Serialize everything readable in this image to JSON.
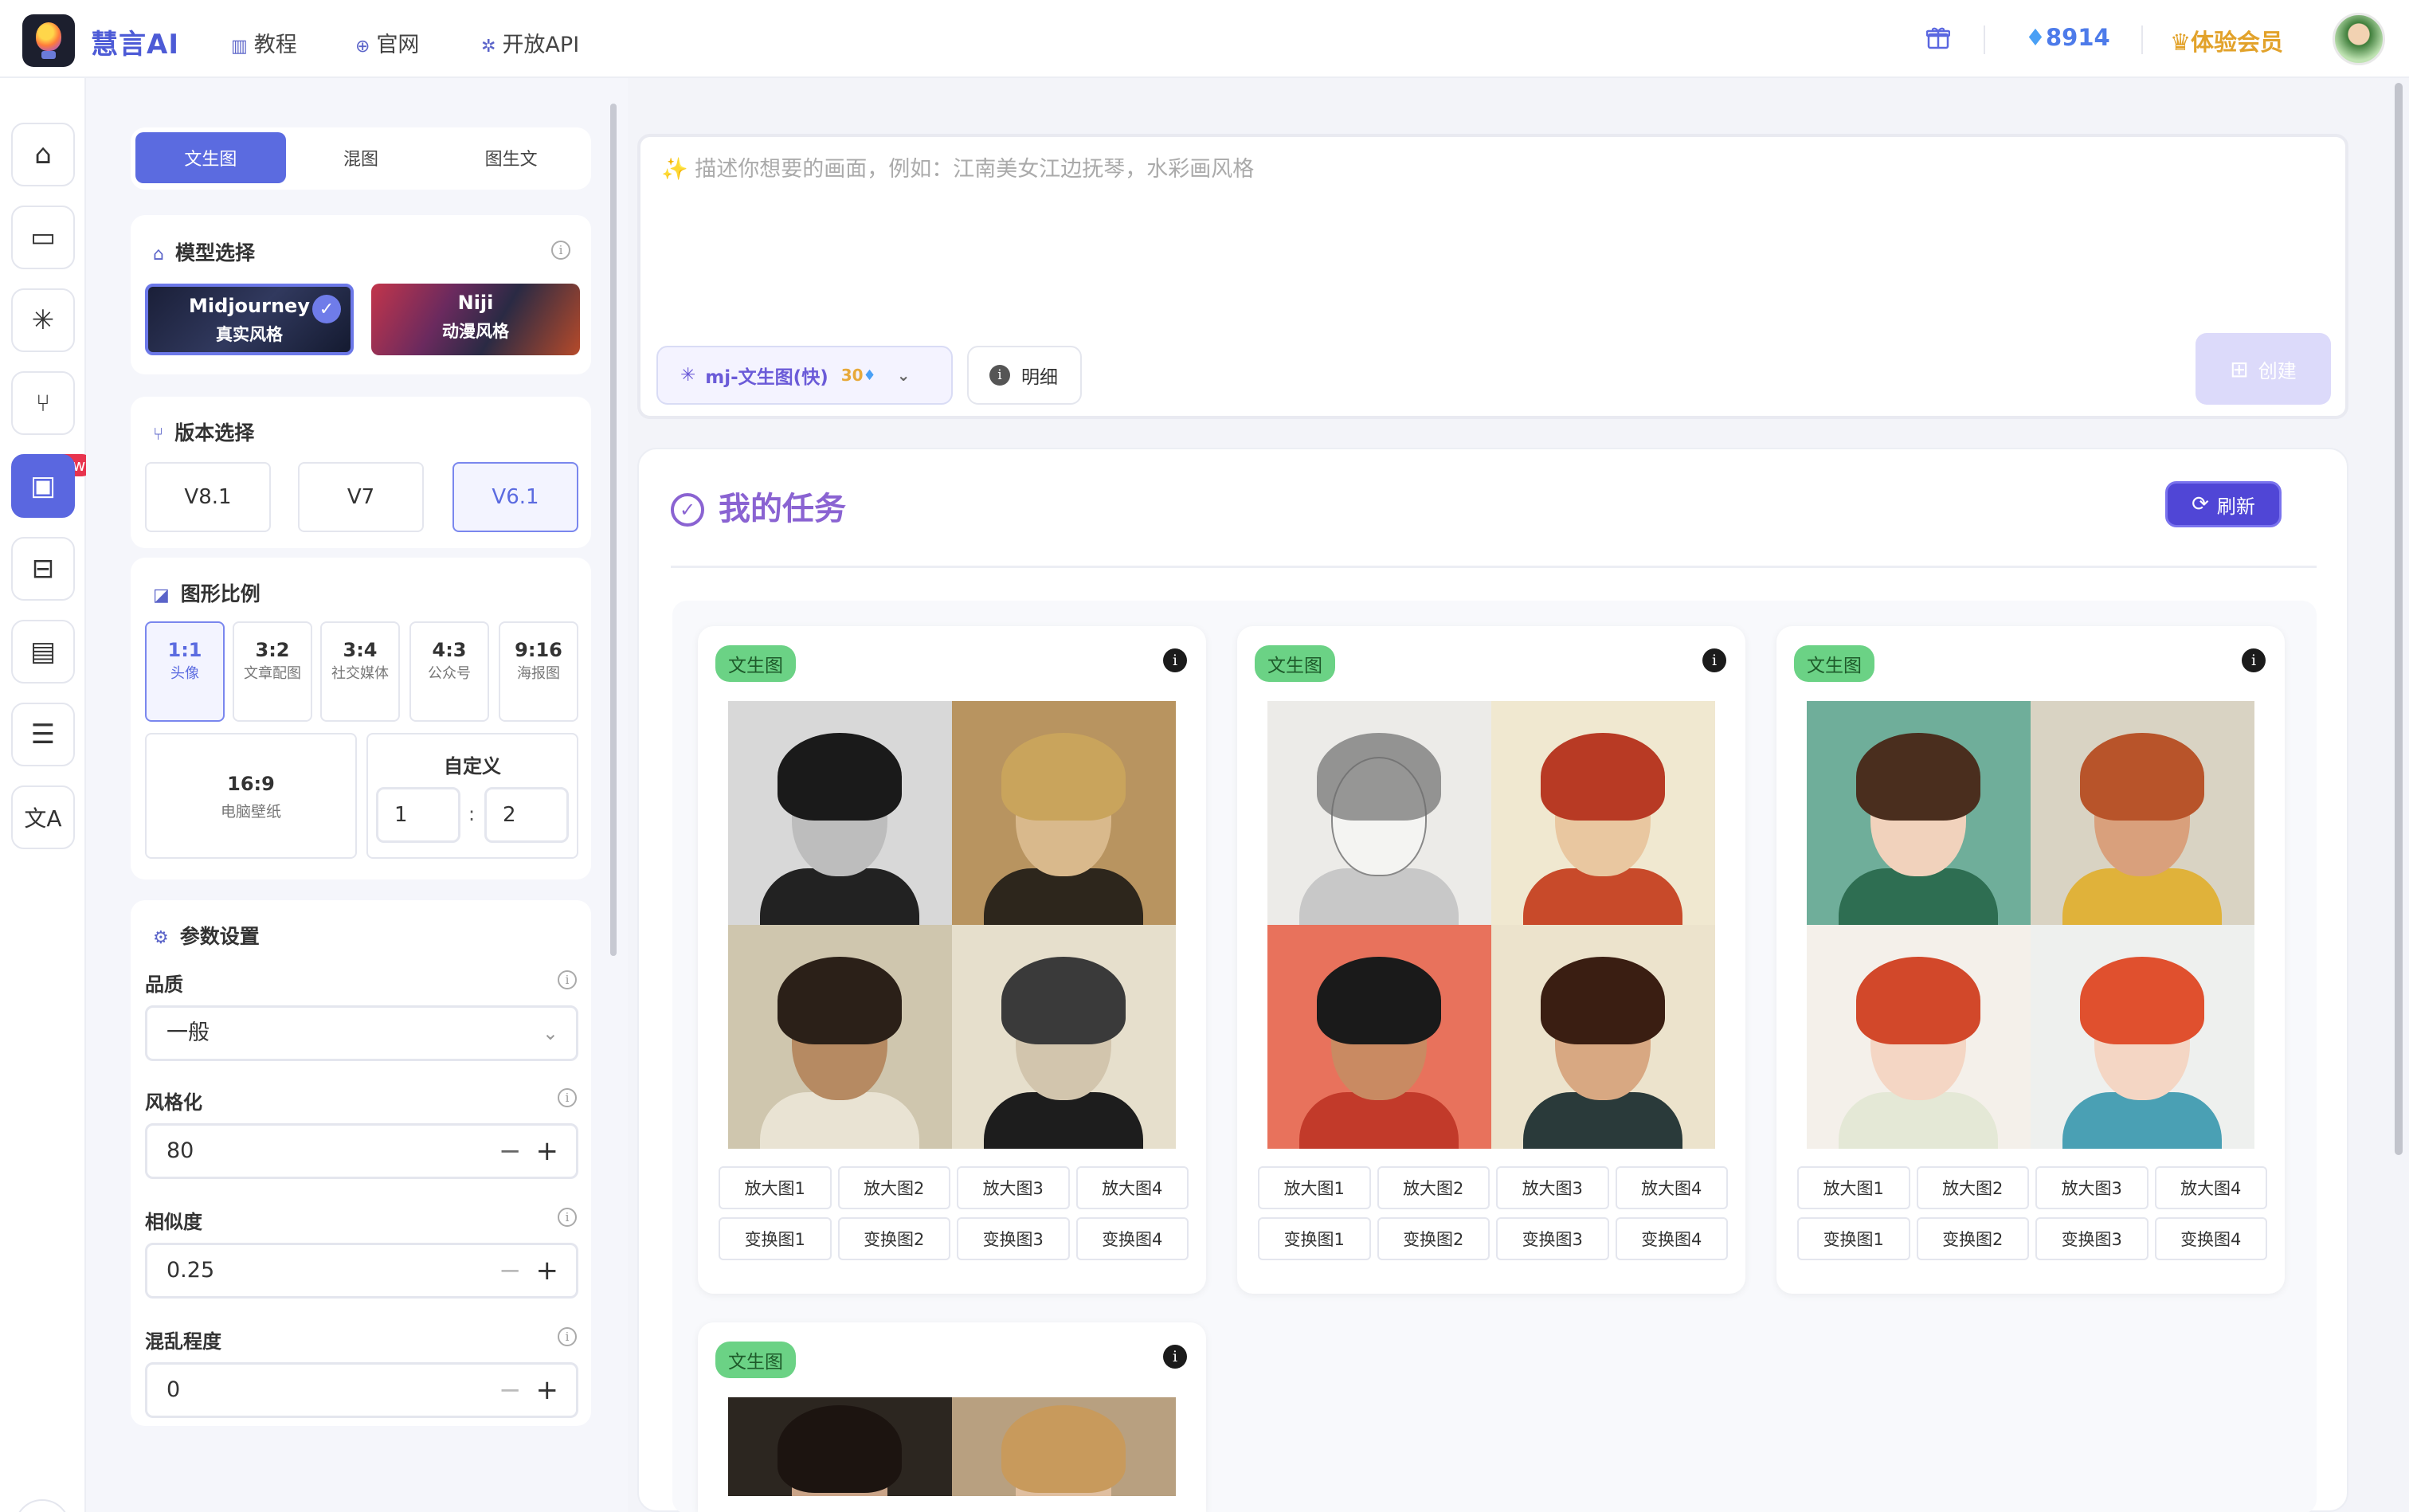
{
  "app": {
    "brand": "慧言AI",
    "nav": [
      {
        "icon": "book-icon",
        "glyph": "▥",
        "label": "教程"
      },
      {
        "icon": "globe-icon",
        "glyph": "⊕",
        "label": "官网"
      },
      {
        "icon": "api-icon",
        "glyph": "✲",
        "label": "开放API"
      }
    ],
    "gems": "8914",
    "vip": "体验会员"
  },
  "rail": {
    "items": [
      "home-icon",
      "chat-icon",
      "sparkle-icon",
      "branch-icon",
      "image-gen-icon",
      "bag-icon",
      "gallery-icon",
      "list-indent-icon",
      "translate-icon"
    ],
    "new_badge": "new"
  },
  "panel": {
    "tabs": [
      "文生图",
      "混图",
      "图生文"
    ],
    "active_tab": 0,
    "model_title": "模型选择",
    "models": [
      {
        "name": "Midjourney",
        "desc": "真实风格",
        "selected": true
      },
      {
        "name": "Niji",
        "desc": "动漫风格",
        "selected": false
      }
    ],
    "version_title": "版本选择",
    "versions": [
      "V8.1",
      "V7",
      "V6.1"
    ],
    "active_version": 2,
    "ratio_title": "图形比例",
    "ratios": [
      {
        "r": "1:1",
        "d": "头像"
      },
      {
        "r": "3:2",
        "d": "文章配图"
      },
      {
        "r": "3:4",
        "d": "社交媒体"
      },
      {
        "r": "4:3",
        "d": "公众号"
      },
      {
        "r": "9:16",
        "d": "海报图"
      }
    ],
    "ratio_wide": {
      "r": "16:9",
      "d": "电脑壁纸"
    },
    "custom": {
      "label": "自定义",
      "a": "1",
      "sep": ":",
      "b": "2"
    },
    "params_title": "参数设置",
    "quality_label": "品质",
    "quality_value": "一般",
    "stylize_label": "风格化",
    "stylize_value": "80",
    "similarity_label": "相似度",
    "similarity_value": "0.25",
    "chaos_label": "混乱程度",
    "chaos_value": "0"
  },
  "prompt": {
    "placeholder": "描述你想要的画面，例如：江南美女江边抚琴，水彩画风格",
    "mode": "mj-文生图(快)",
    "cost": "30",
    "detail": "明细",
    "create": "创建"
  },
  "tasks": {
    "title": "我的任务",
    "refresh": "刷新",
    "tag": "文生图",
    "upscale": [
      "放大图1",
      "放大图2",
      "放大图3",
      "放大图4"
    ],
    "vary": [
      "变换图1",
      "变换图2",
      "变换图3",
      "变换图4"
    ],
    "colors": {
      "tag_green": "#6bd285",
      "accent": "#5b6be0",
      "title_purple": "#8a63d2"
    }
  }
}
